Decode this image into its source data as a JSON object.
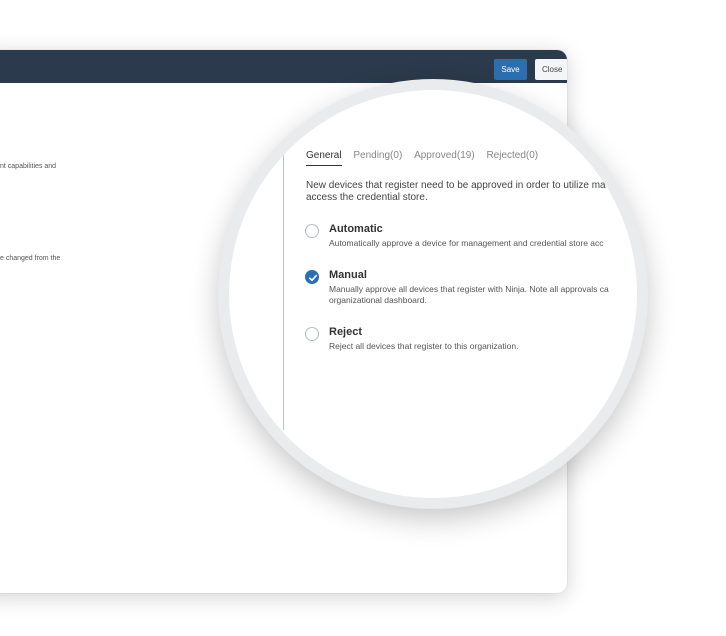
{
  "window": {
    "save_label": "Save",
    "close_label": "Close",
    "background_text": [
      "nt capabilities and",
      "e changed from the"
    ]
  },
  "panel": {
    "tabs": [
      {
        "label": "General",
        "active": true
      },
      {
        "label": "Pending(0)",
        "active": false
      },
      {
        "label": "Approved(19)",
        "active": false
      },
      {
        "label": "Rejected(0)",
        "active": false
      }
    ],
    "intro_line1": "New devices that register need to be approved in order to utilize ma",
    "intro_line2": "access the credential store.",
    "options": [
      {
        "title": "Automatic",
        "desc_line1": "Automatically approve a device for management and credential store acc",
        "desc_line2": "",
        "selected": false
      },
      {
        "title": "Manual",
        "desc_line1": "Manually approve all devices that register with Ninja. Note all approvals ca",
        "desc_line2": "organizational dashboard.",
        "selected": true
      },
      {
        "title": "Reject",
        "desc_line1": "Reject all devices that register to this organization.",
        "desc_line2": "",
        "selected": false
      }
    ]
  },
  "colors": {
    "header": "#2b3a4c",
    "accent": "#2c6fb0"
  },
  "icons": {
    "selected_radio": "check-icon"
  }
}
